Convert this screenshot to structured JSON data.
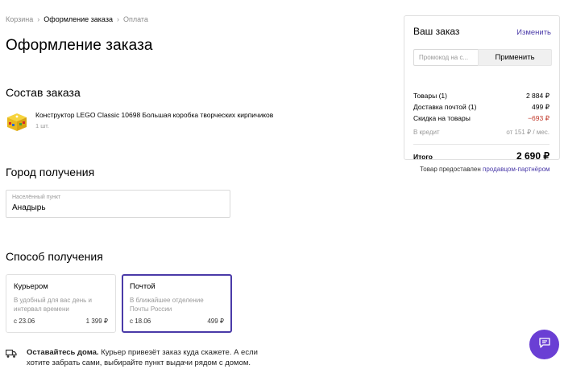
{
  "breadcrumb": {
    "items": [
      "Корзина",
      "Оформление заказа",
      "Оплата"
    ]
  },
  "page": {
    "title": "Оформление заказа"
  },
  "order_section": {
    "title": "Состав заказа",
    "product_name": "Конструктор LEGO Classic 10698 Большая коробка творческих кирпичиков",
    "product_qty": "1 шт."
  },
  "city_section": {
    "title": "Город получения",
    "field_label": "Населённый пункт",
    "field_value": "Анадырь"
  },
  "delivery_section": {
    "title": "Способ получения",
    "options": [
      {
        "title": "Курьером",
        "description": "В удобный для вас день и интервал времени",
        "date": "с 23.06",
        "price": "1 399 ₽",
        "selected": false
      },
      {
        "title": "Почтой",
        "description": "В ближайшее отделение Почты России",
        "date": "с 18.06",
        "price": "499 ₽",
        "selected": true
      }
    ]
  },
  "note": {
    "bold": "Оставайтесь дома.",
    "text": " Курьер привезёт заказ куда скажете. А если хотите забрать сами, выбирайте пункт выдачи рядом с домом."
  },
  "summary": {
    "title": "Ваш заказ",
    "edit_label": "Изменить",
    "promo_placeholder": "Промокод на с...",
    "promo_button": "Применить",
    "rows": [
      {
        "label": "Товары (1)",
        "value": "2 884 ₽"
      },
      {
        "label": "Доставка почтой (1)",
        "value": "499 ₽"
      },
      {
        "label": "Скидка на товары",
        "value": "−693 ₽"
      }
    ],
    "credit_label": "В кредит",
    "credit_value": "от 151 ₽ / мес.",
    "total_label": "Итого",
    "total_value": "2 690 ₽"
  },
  "seller": {
    "text": "Товар предоставлен ",
    "link": "продавцом-партнёром"
  },
  "colors": {
    "accent": "#4a3aa8",
    "chat_button": "#6a3fd4",
    "discount": "#c0392b"
  },
  "icons": {
    "product": "lego-box-icon",
    "note": "truck-icon",
    "chat": "chat-icon"
  }
}
